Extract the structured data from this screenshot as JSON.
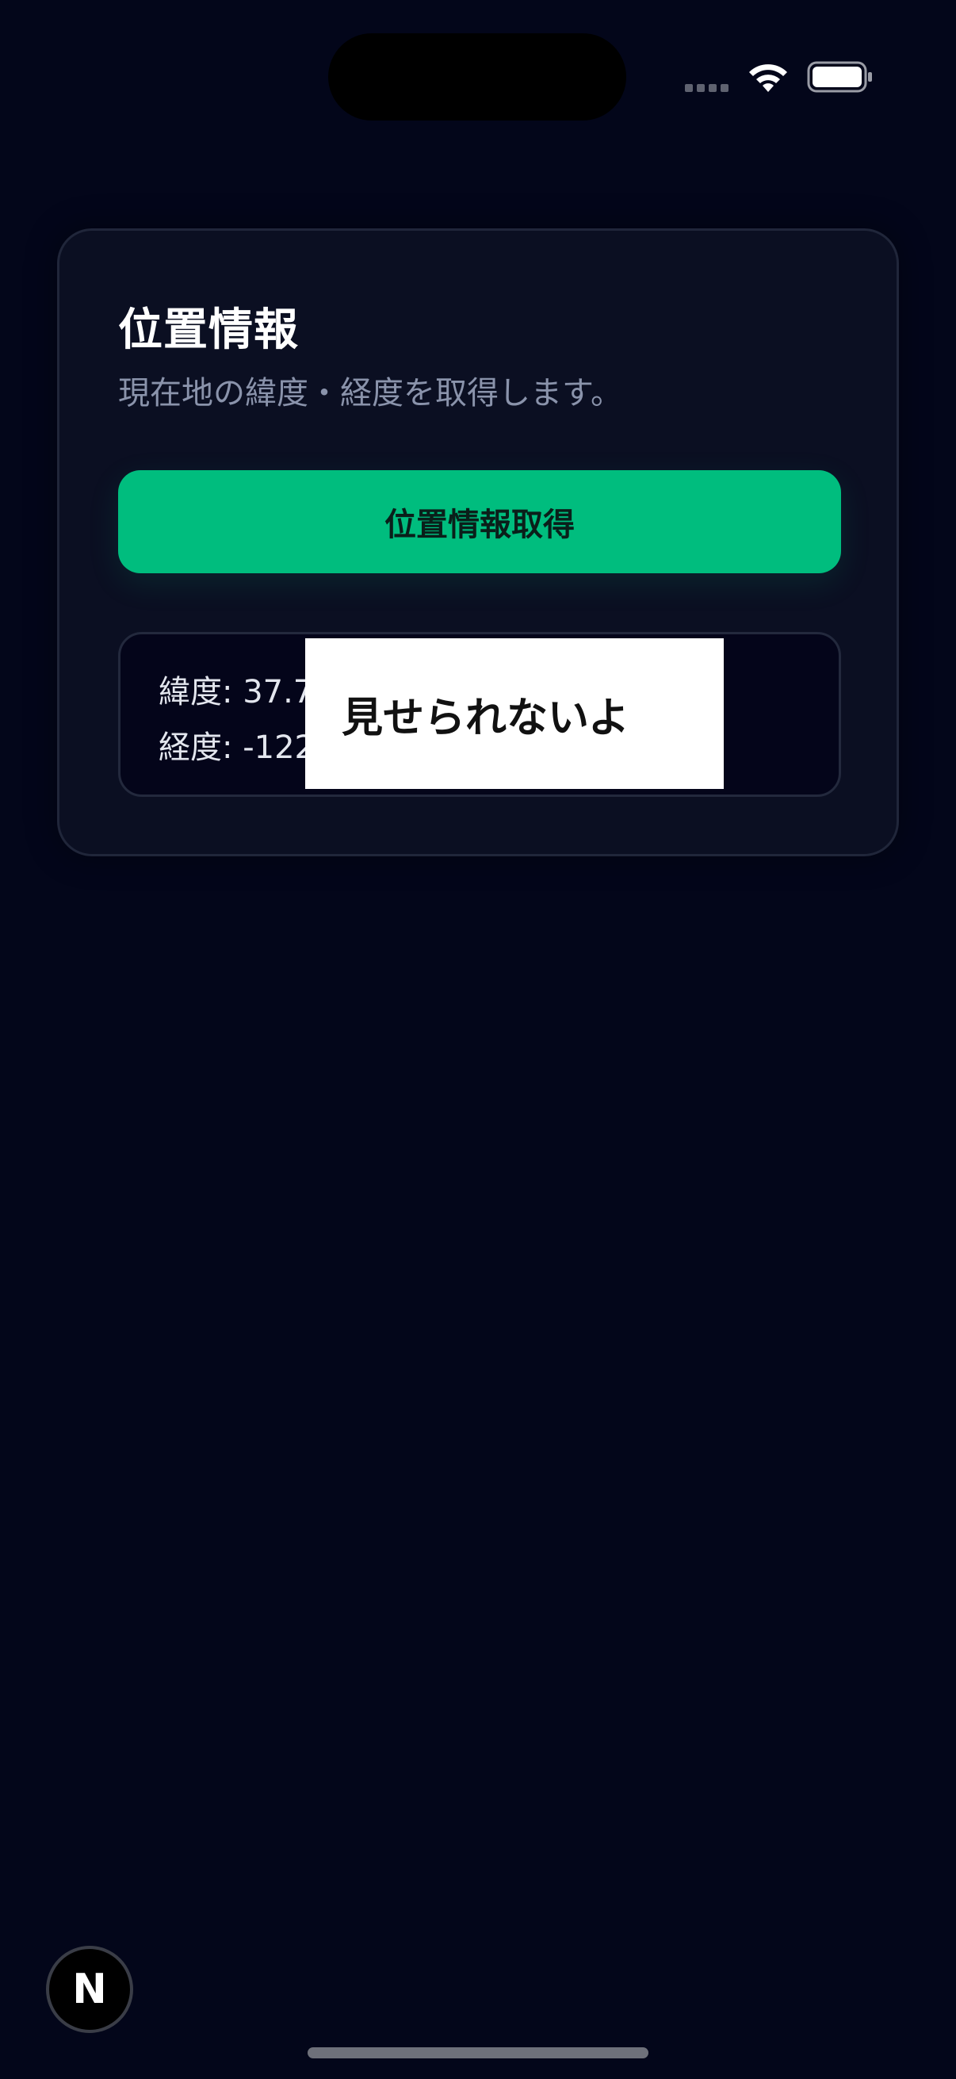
{
  "status_bar": {
    "wifi_icon": "wifi-icon",
    "battery_icon": "battery-icon",
    "signal_icon": "cellular-signal-icon"
  },
  "card": {
    "title": "位置情報",
    "subtitle": "現在地の緯度・経度を取得します。",
    "button_label": "位置情報取得",
    "result": {
      "latitude_text": "緯度: 37.7",
      "longitude_text": "経度: -122"
    }
  },
  "overlay": {
    "text": "見せられないよ"
  },
  "dev_badge": {
    "label": "N"
  },
  "colors": {
    "background": "#03061a",
    "card": "#0b0f22",
    "accent": "#00bd7e",
    "subtitle": "#8a93ab"
  }
}
